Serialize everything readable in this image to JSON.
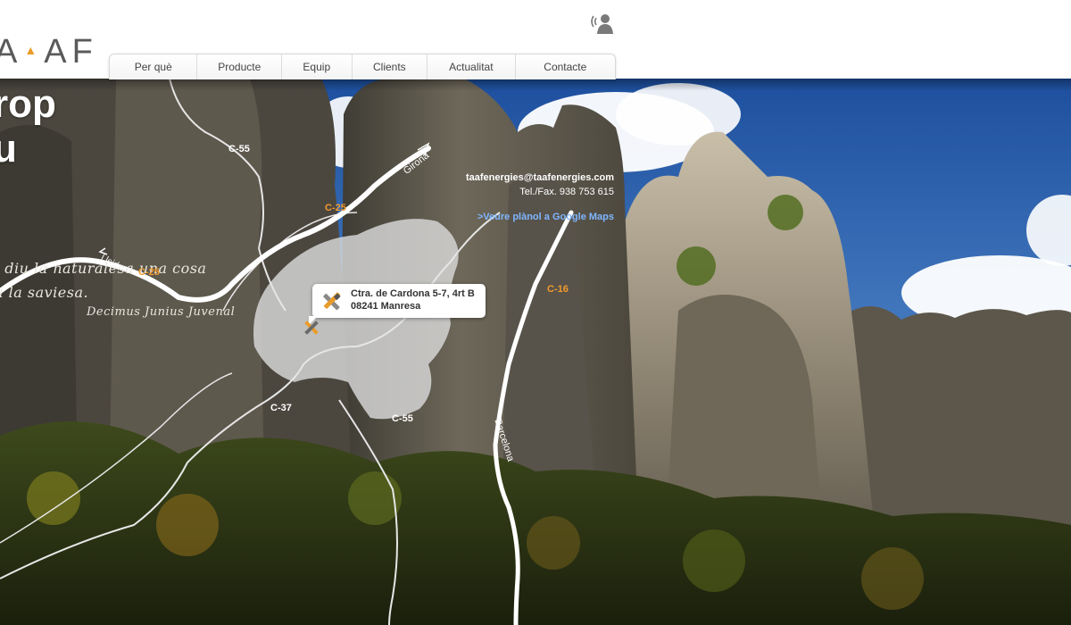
{
  "header": {
    "logo_text": "AAF",
    "contact_icon": "headset-contact-icon"
  },
  "nav": {
    "items": [
      {
        "label": "Per què"
      },
      {
        "label": "Producte"
      },
      {
        "label": "Equip"
      },
      {
        "label": "Clients"
      },
      {
        "label": "Actualitat"
      },
      {
        "label": "Contacte"
      }
    ]
  },
  "hero": {
    "title_line1": "rop",
    "title_line2": "u",
    "quote_line1": "i diu la naturalesa una cosa",
    "quote_line2": "a la saviesa.",
    "quote_author": "Decimus Junius Juvenal"
  },
  "contact": {
    "email": "taafenergies@taafenergies.com",
    "phone": "Tel./Fax. 938 753 615",
    "maps_link": ">Veure plànol a Google Maps"
  },
  "map": {
    "address_line1": "Ctra. de Cardona 5-7, 4rt B",
    "address_line2": "08241 Manresa",
    "roads": {
      "c55_top": "C-55",
      "c25_mid": "C-25",
      "c25_left": "C-25",
      "c16": "C-16",
      "c37": "C-37",
      "c55_bottom": "C-55",
      "girona": "Girona",
      "lleida": "Lleida",
      "barcelona": "Barcelona"
    },
    "colors": {
      "highway_label": "#f39a2d",
      "road_line": "#ffffff",
      "town_area": "#d9d9d9"
    }
  }
}
